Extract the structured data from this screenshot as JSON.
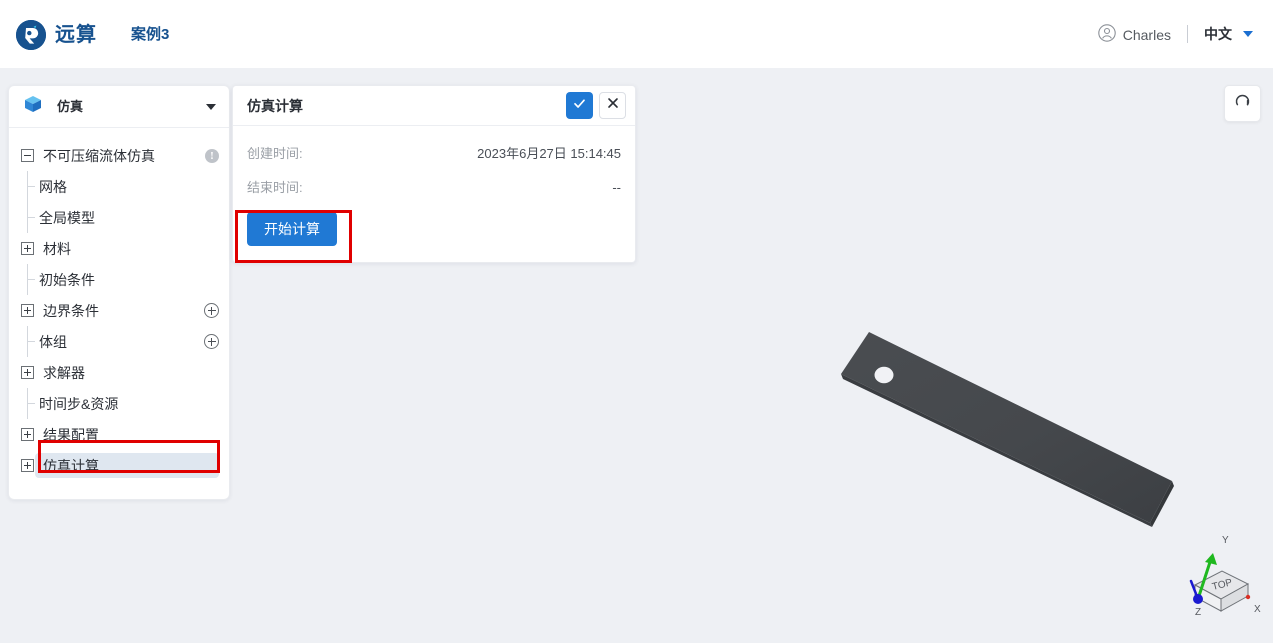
{
  "header": {
    "logo_icon": "yuansuan-logo-icon",
    "brand_name": "远算",
    "project_name": "案例3",
    "user_icon": "user-circle-icon",
    "user_name": "Charles",
    "language": "中文",
    "language_caret_icon": "chevron-down-icon",
    "brand_color": "#17528f"
  },
  "sidebar": {
    "module_icon": "cube-icon",
    "module_title": "仿真",
    "collapse_icon": "chevron-down-icon",
    "tree": [
      {
        "label": "不可压缩流体仿真",
        "level": "root",
        "toggle": "minus",
        "right_icon": "info-badge-icon",
        "selected": false
      },
      {
        "label": "网格",
        "level": "child",
        "toggle": "leaf",
        "right_icon": "",
        "selected": false
      },
      {
        "label": "全局模型",
        "level": "child",
        "toggle": "leaf",
        "right_icon": "",
        "selected": false
      },
      {
        "label": "材料",
        "level": "root",
        "toggle": "plus",
        "right_icon": "",
        "selected": false
      },
      {
        "label": "初始条件",
        "level": "child",
        "toggle": "leaf",
        "right_icon": "",
        "selected": false
      },
      {
        "label": "边界条件",
        "level": "root",
        "toggle": "plus",
        "right_icon": "add-circle-icon",
        "selected": false
      },
      {
        "label": "体组",
        "level": "child",
        "toggle": "leaf",
        "right_icon": "add-circle-icon",
        "selected": false
      },
      {
        "label": "求解器",
        "level": "root",
        "toggle": "plus",
        "right_icon": "",
        "selected": false
      },
      {
        "label": "时间步&资源",
        "level": "child",
        "toggle": "leaf",
        "right_icon": "",
        "selected": false
      },
      {
        "label": "结果配置",
        "level": "root",
        "toggle": "plus",
        "right_icon": "",
        "selected": false
      },
      {
        "label": "仿真计算",
        "level": "root",
        "toggle": "plus",
        "right_icon": "",
        "selected": true
      }
    ]
  },
  "dialog": {
    "title": "仿真计算",
    "confirm_icon": "check-icon",
    "cancel_icon": "close-icon",
    "fields": [
      {
        "label": "创建时间:",
        "value": "2023年6月27日 15:14:45"
      },
      {
        "label": "结束时间:",
        "value": "--"
      }
    ],
    "start_button_label": "开始计算",
    "accent_color": "#2079d4"
  },
  "viewport": {
    "reset_view_icon": "reset-rotate-icon",
    "model_name": "plate-with-hole",
    "model_color": "#43464a",
    "background_color": "#eef0f4",
    "gizmo": {
      "face_label": "TOP",
      "axis_x": "X",
      "axis_y": "Y",
      "axis_z": "Z",
      "x_color": "#d93025",
      "y_color": "#1fb81f",
      "z_color": "#1a1ad0"
    }
  },
  "annotations": [
    {
      "name": "sidebar-item-highlight",
      "color": "#e00000"
    },
    {
      "name": "start-button-highlight",
      "color": "#e00000"
    }
  ]
}
